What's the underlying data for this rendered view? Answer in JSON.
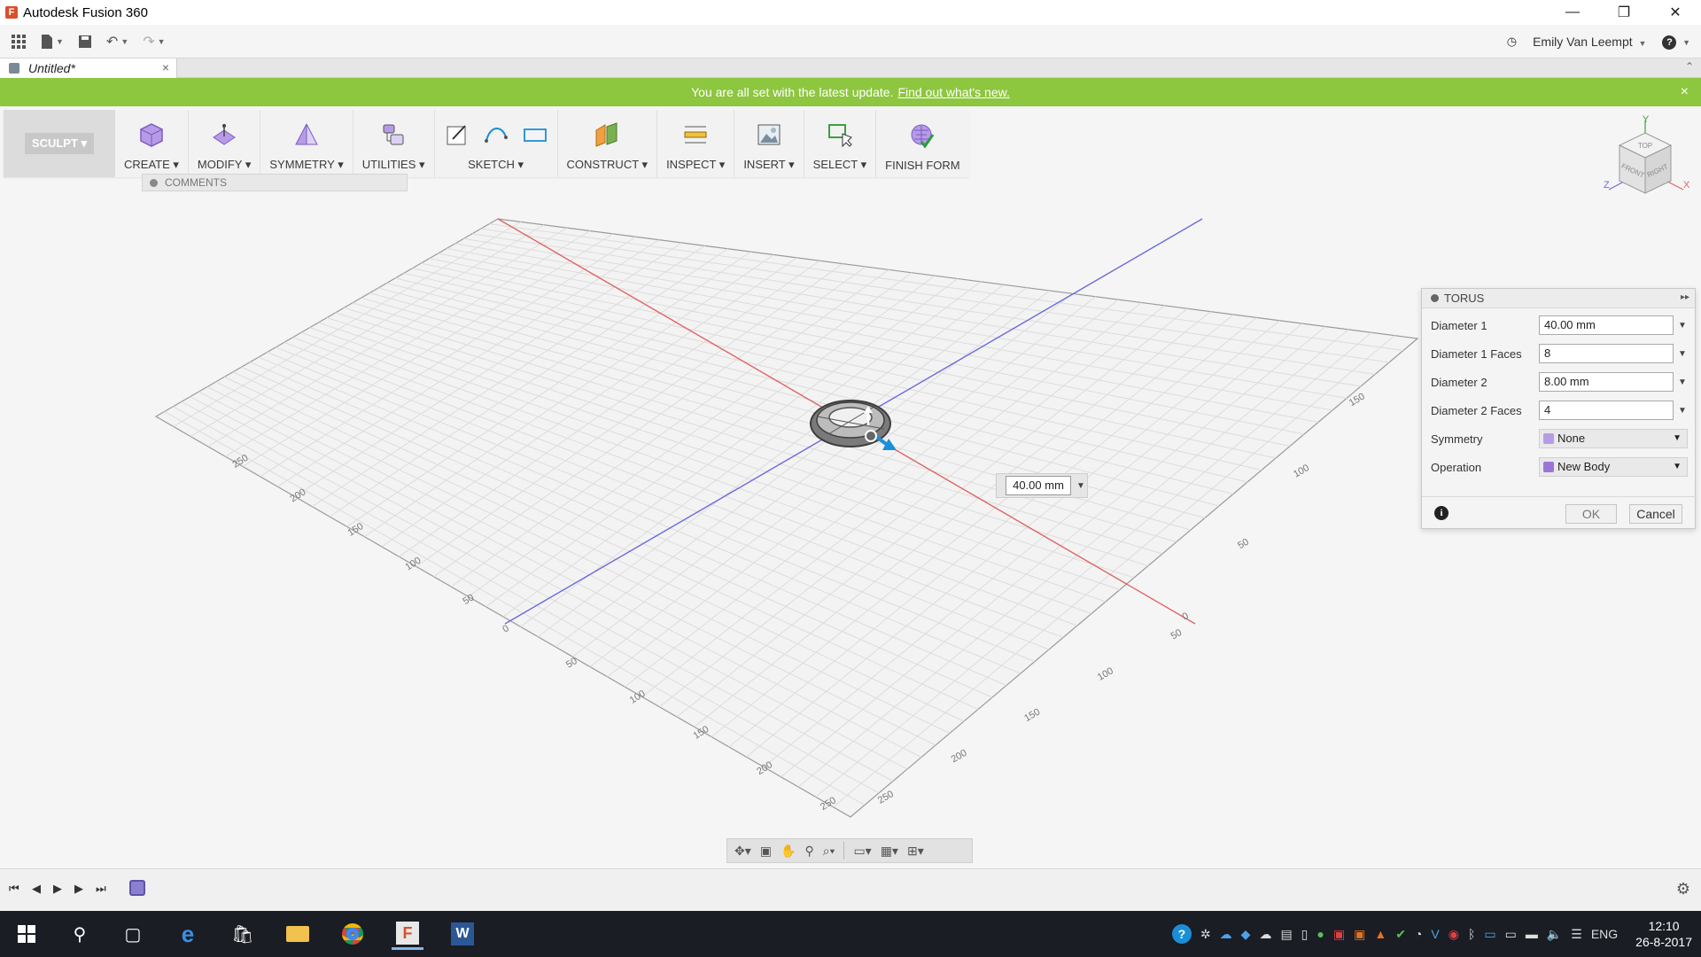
{
  "window": {
    "title": "Autodesk Fusion 360",
    "icon_letter": "F",
    "minimize_glyph": "—",
    "restore_glyph": "❐",
    "close_glyph": "✕"
  },
  "quickaccess": {
    "user_name": "Emily Van Leempt",
    "help_glyph": "?"
  },
  "document_tab": {
    "title": "Untitled*",
    "close_glyph": "×"
  },
  "banner": {
    "message": "You are all set with the latest update.",
    "link_text": "Find out what's new.",
    "close_glyph": "×"
  },
  "toolbar": {
    "workspace": "SCULPT ▾",
    "groups": [
      {
        "label": "CREATE ▾"
      },
      {
        "label": "MODIFY ▾"
      },
      {
        "label": "SYMMETRY ▾"
      },
      {
        "label": "UTILITIES ▾"
      },
      {
        "label": "SKETCH ▾"
      },
      {
        "label": "CONSTRUCT ▾"
      },
      {
        "label": "INSPECT ▾"
      },
      {
        "label": "INSERT ▾"
      },
      {
        "label": "SELECT ▾"
      },
      {
        "label": "FINISH FORM"
      }
    ]
  },
  "comments": {
    "label": "COMMENTS"
  },
  "viewcube": {
    "top": "TOP",
    "front": "FRONT",
    "right": "RIGHT",
    "axis_x": "X",
    "axis_y": "Y",
    "axis_z": "Z"
  },
  "grid_labels": {
    "left": [
      "250",
      "200",
      "150",
      "100",
      "50"
    ],
    "bottom_left": [
      "0",
      "50",
      "100",
      "150",
      "200",
      "250"
    ],
    "bottom_right": [
      "250",
      "200",
      "150",
      "100",
      "50"
    ],
    "right": [
      "0",
      "50",
      "100",
      "150"
    ]
  },
  "torus_panel": {
    "title": "TORUS",
    "fields": [
      {
        "label": "Diameter 1",
        "value": "40.00 mm"
      },
      {
        "label": "Diameter 1 Faces",
        "value": "8"
      },
      {
        "label": "Diameter 2",
        "value": "8.00 mm"
      },
      {
        "label": "Diameter 2 Faces",
        "value": "4"
      }
    ],
    "symmetry_label": "Symmetry",
    "symmetry_value": "None",
    "operation_label": "Operation",
    "operation_value": "New Body",
    "ok_label": "OK",
    "cancel_label": "Cancel",
    "info_glyph": "i"
  },
  "dimension_input": {
    "value": "40.00 mm"
  },
  "taskbar": {
    "language": "ENG",
    "time": "12:10",
    "date": "26-8-2017"
  },
  "colors": {
    "banner": "#8dc63f",
    "axis_red": "#e06464",
    "axis_blue": "#6a6ae0",
    "grid_line": "#dcdcdc",
    "accent_blue": "#1a8fd6"
  }
}
